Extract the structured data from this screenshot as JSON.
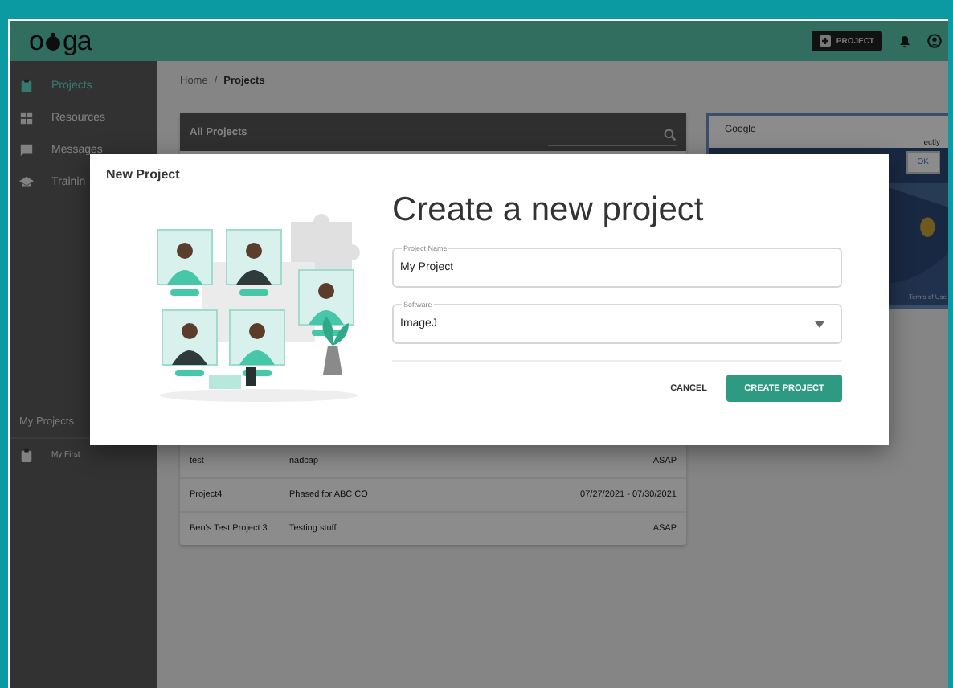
{
  "header": {
    "logo_start": "o",
    "logo_end": "ga",
    "project_button": "PROJECT"
  },
  "sidebar": {
    "items": [
      {
        "label": "Projects",
        "selected": true
      },
      {
        "label": "Resources",
        "selected": false
      },
      {
        "label": "Messages",
        "selected": false
      },
      {
        "label": "Trainin",
        "selected": false
      }
    ],
    "section_title": "My Projects",
    "projects": [
      {
        "label": "My First",
        "selected": false
      }
    ]
  },
  "breadcrumb": {
    "home": "Home",
    "separator": "/",
    "current": "Projects"
  },
  "projects_card": {
    "title": "All Projects",
    "rows": [
      [
        "test",
        "nadcap",
        "ASAP"
      ],
      [
        "Project4",
        "Phased for ABC CO",
        "07/27/2021 - 07/30/2021"
      ],
      [
        "Ben's Test Project 3",
        "Testing stuff",
        "ASAP"
      ]
    ]
  },
  "map_card": {
    "title": "Google",
    "text": "ectly",
    "button": "OK",
    "footer": "Terms of Use"
  },
  "dialog": {
    "title": "New Project",
    "heading": "Create a new project",
    "fields": [
      {
        "kind": "text",
        "label": "Project Name",
        "value": "My Project"
      },
      {
        "kind": "select",
        "label": "Software",
        "value": "ImageJ"
      }
    ],
    "cancel": "CANCEL",
    "submit": "CREATE PROJECT"
  }
}
